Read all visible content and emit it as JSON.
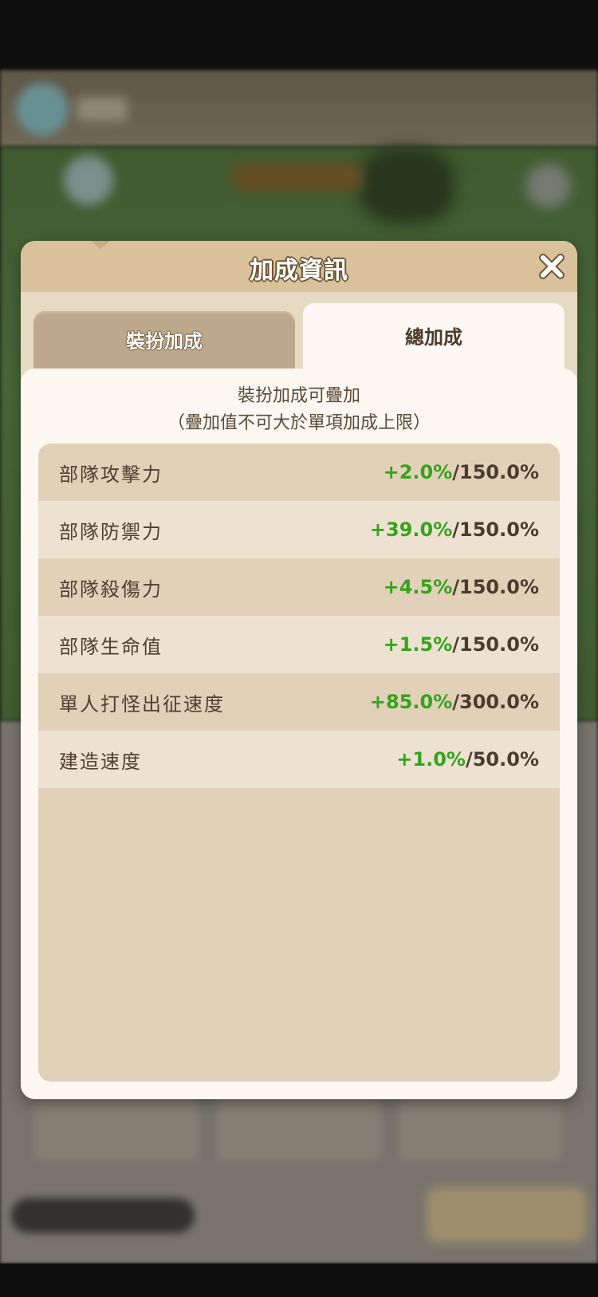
{
  "dialog": {
    "title": "加成資訊",
    "close_icon": "close-x-icon"
  },
  "tabs": [
    {
      "label": "裝扮加成",
      "selected": false
    },
    {
      "label": "總加成",
      "selected": true
    }
  ],
  "description": {
    "line1": "裝扮加成可疊加",
    "line2": "（疊加值不可大於單項加成上限）"
  },
  "stats": [
    {
      "name": "部隊攻擊力",
      "bonus": "+2.0%",
      "sep": "/",
      "cap": "150.0%"
    },
    {
      "name": "部隊防禦力",
      "bonus": "+39.0%",
      "sep": "/",
      "cap": "150.0%"
    },
    {
      "name": "部隊殺傷力",
      "bonus": "+4.5%",
      "sep": "/",
      "cap": "150.0%"
    },
    {
      "name": "部隊生命值",
      "bonus": "+1.5%",
      "sep": "/",
      "cap": "150.0%"
    },
    {
      "name": "單人打怪出征速度",
      "bonus": "+85.0%",
      "sep": "/",
      "cap": "300.0%"
    },
    {
      "name": "建造速度",
      "bonus": "+1.0%",
      "sep": "/",
      "cap": "50.0%"
    }
  ],
  "colors": {
    "bonus_green": "#36a31c",
    "header_tan": "#d9c29b",
    "row_dark": "#e1d1b8",
    "row_light": "#ede2d2"
  }
}
